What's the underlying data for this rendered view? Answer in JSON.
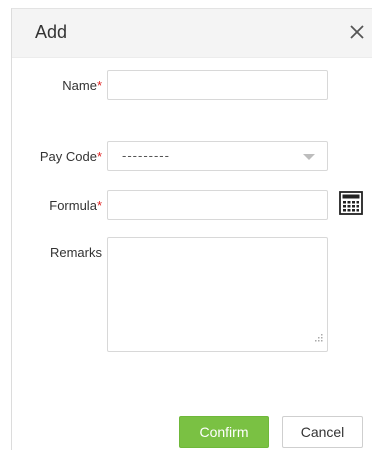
{
  "dialog": {
    "title": "Add",
    "close_icon": "close-icon"
  },
  "form": {
    "name": {
      "label": "Name",
      "required_mark": "*",
      "value": ""
    },
    "pay_code": {
      "label": "Pay Code",
      "required_mark": "*",
      "selected": "---------"
    },
    "formula": {
      "label": "Formula",
      "required_mark": "*",
      "value": "",
      "icon": "calculator-icon"
    },
    "remarks": {
      "label": "Remarks",
      "value": ""
    }
  },
  "buttons": {
    "confirm": "Confirm",
    "cancel": "Cancel"
  },
  "colors": {
    "accent": "#7ac143",
    "required": "#e02020"
  }
}
